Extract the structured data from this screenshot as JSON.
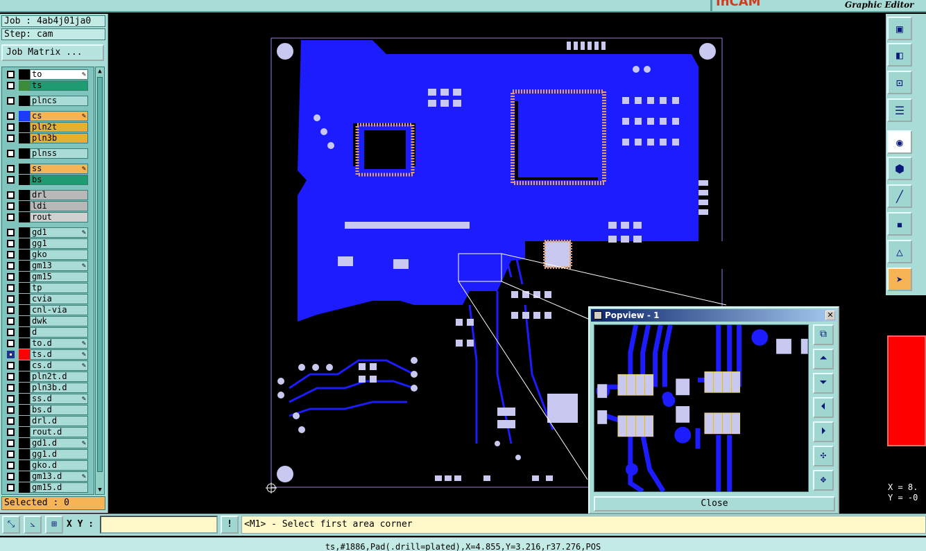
{
  "title_bar": {
    "logo": "InCAM",
    "subtitle": "Graphic Editor"
  },
  "left_panel": {
    "job_label": "Job : 4ab4j01ja0",
    "step_label": "Step: cam",
    "job_matrix_button": "Job Matrix ...",
    "selected_count": "Selected : 0",
    "layers": [
      {
        "name": "to",
        "swatch": "#000000",
        "bg": "#ffffff",
        "edit": true,
        "on": false
      },
      {
        "name": "ts",
        "swatch": "#3d8c3d",
        "bg": "#1f9b72",
        "edit": false,
        "on": false
      },
      {
        "name": "plncs",
        "swatch": "#000000",
        "bg": "#a9dcd6",
        "edit": false,
        "on": false
      },
      {
        "name": "cs",
        "swatch": "#1c3bff",
        "bg": "#f6b454",
        "edit": true,
        "on": false
      },
      {
        "name": "pln2t",
        "swatch": "#000000",
        "bg": "#e3b030",
        "edit": false,
        "on": false
      },
      {
        "name": "pln3b",
        "swatch": "#000000",
        "bg": "#e3b030",
        "edit": false,
        "on": false
      },
      {
        "name": "plnss",
        "swatch": "#000000",
        "bg": "#a9dcd6",
        "edit": false,
        "on": false
      },
      {
        "name": "ss",
        "swatch": "#000000",
        "bg": "#f6b454",
        "edit": true,
        "on": false
      },
      {
        "name": "bs",
        "swatch": "#000000",
        "bg": "#1f9b72",
        "edit": false,
        "on": false
      },
      {
        "name": "drl",
        "swatch": "#000000",
        "bg": "#b8b8b8",
        "edit": false,
        "on": false
      },
      {
        "name": "ldi",
        "swatch": "#000000",
        "bg": "#b8b8b8",
        "edit": false,
        "on": false
      },
      {
        "name": "rout",
        "swatch": "#000000",
        "bg": "#d0d0d0",
        "edit": false,
        "on": false
      },
      {
        "name": "gd1",
        "swatch": "#000000",
        "bg": "#a9dcd6",
        "edit": true,
        "on": false
      },
      {
        "name": "gg1",
        "swatch": "#000000",
        "bg": "#a9dcd6",
        "edit": false,
        "on": false
      },
      {
        "name": "gko",
        "swatch": "#000000",
        "bg": "#a9dcd6",
        "edit": false,
        "on": false
      },
      {
        "name": "gm13",
        "swatch": "#000000",
        "bg": "#a9dcd6",
        "edit": true,
        "on": false
      },
      {
        "name": "gm15",
        "swatch": "#000000",
        "bg": "#a9dcd6",
        "edit": false,
        "on": false
      },
      {
        "name": "tp",
        "swatch": "#000000",
        "bg": "#a9dcd6",
        "edit": false,
        "on": false
      },
      {
        "name": "cvia",
        "swatch": "#000000",
        "bg": "#a9dcd6",
        "edit": false,
        "on": false
      },
      {
        "name": "cnl-via",
        "swatch": "#000000",
        "bg": "#a9dcd6",
        "edit": false,
        "on": false
      },
      {
        "name": "dwk",
        "swatch": "#000000",
        "bg": "#a9dcd6",
        "edit": false,
        "on": false
      },
      {
        "name": "d",
        "swatch": "#000000",
        "bg": "#a9dcd6",
        "edit": false,
        "on": false
      },
      {
        "name": "to.d",
        "swatch": "#000000",
        "bg": "#a9dcd6",
        "edit": true,
        "on": false
      },
      {
        "name": "ts.d",
        "swatch": "#ff0000",
        "bg": "#a9dcd6",
        "edit": true,
        "on": true
      },
      {
        "name": "cs.d",
        "swatch": "#000000",
        "bg": "#a9dcd6",
        "edit": true,
        "on": false
      },
      {
        "name": "pln2t.d",
        "swatch": "#000000",
        "bg": "#a9dcd6",
        "edit": false,
        "on": false
      },
      {
        "name": "pln3b.d",
        "swatch": "#000000",
        "bg": "#a9dcd6",
        "edit": false,
        "on": false
      },
      {
        "name": "ss.d",
        "swatch": "#000000",
        "bg": "#a9dcd6",
        "edit": true,
        "on": false
      },
      {
        "name": "bs.d",
        "swatch": "#000000",
        "bg": "#a9dcd6",
        "edit": false,
        "on": false
      },
      {
        "name": "drl.d",
        "swatch": "#000000",
        "bg": "#a9dcd6",
        "edit": false,
        "on": false
      },
      {
        "name": "rout.d",
        "swatch": "#000000",
        "bg": "#a9dcd6",
        "edit": false,
        "on": false
      },
      {
        "name": "gd1.d",
        "swatch": "#000000",
        "bg": "#a9dcd6",
        "edit": true,
        "on": false
      },
      {
        "name": "gg1.d",
        "swatch": "#000000",
        "bg": "#a9dcd6",
        "edit": false,
        "on": false
      },
      {
        "name": "gko.d",
        "swatch": "#000000",
        "bg": "#a9dcd6",
        "edit": false,
        "on": false
      },
      {
        "name": "gm13.d",
        "swatch": "#000000",
        "bg": "#a9dcd6",
        "edit": true,
        "on": false
      },
      {
        "name": "gm15.d",
        "swatch": "#000000",
        "bg": "#a9dcd6",
        "edit": false,
        "on": false
      }
    ]
  },
  "colors": {
    "copper": "#1c1cff",
    "pads": "#c8c8f0",
    "smd_pads": "#e8a060",
    "outline": "#9a7ae6"
  },
  "popview": {
    "title": "Popview - 1",
    "close_button": "Close"
  },
  "right_panel": {
    "coord_x": "X = 8.",
    "coord_y": "Y = -0"
  },
  "bottom_bar": {
    "xy_label": "X Y :",
    "xy_value": "",
    "prompt": "<M1> - Select first area corner"
  },
  "status_bar": "ts,#1886,Pad(.drill=plated),X=4.855,Y=3.216,r37.276,POS"
}
